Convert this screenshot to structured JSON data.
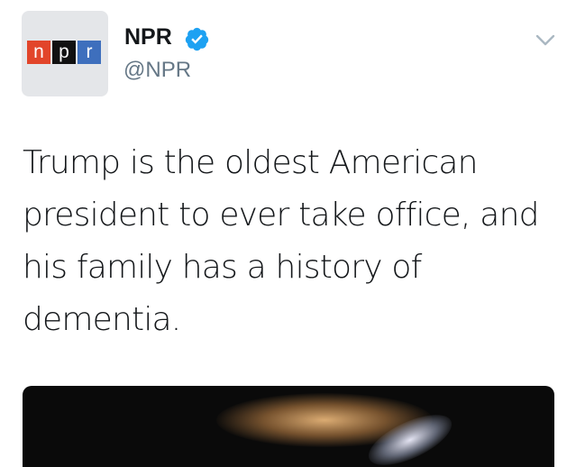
{
  "header": {
    "avatar_icon": "npr-logo-icon",
    "logo_letters": [
      "n",
      "p",
      "r"
    ],
    "name": "NPR",
    "verified_icon": "verified-badge-icon",
    "handle": "@NPR",
    "menu_icon": "chevron-down-icon"
  },
  "tweet": {
    "text": "Trump is the oldest American president to ever take office, and his family has a history of dementia."
  },
  "colors": {
    "npr_red": "#e2452a",
    "npr_black": "#111111",
    "npr_blue": "#3e6fbd",
    "verified_blue": "#1da1f2",
    "handle_gray": "#657786"
  }
}
